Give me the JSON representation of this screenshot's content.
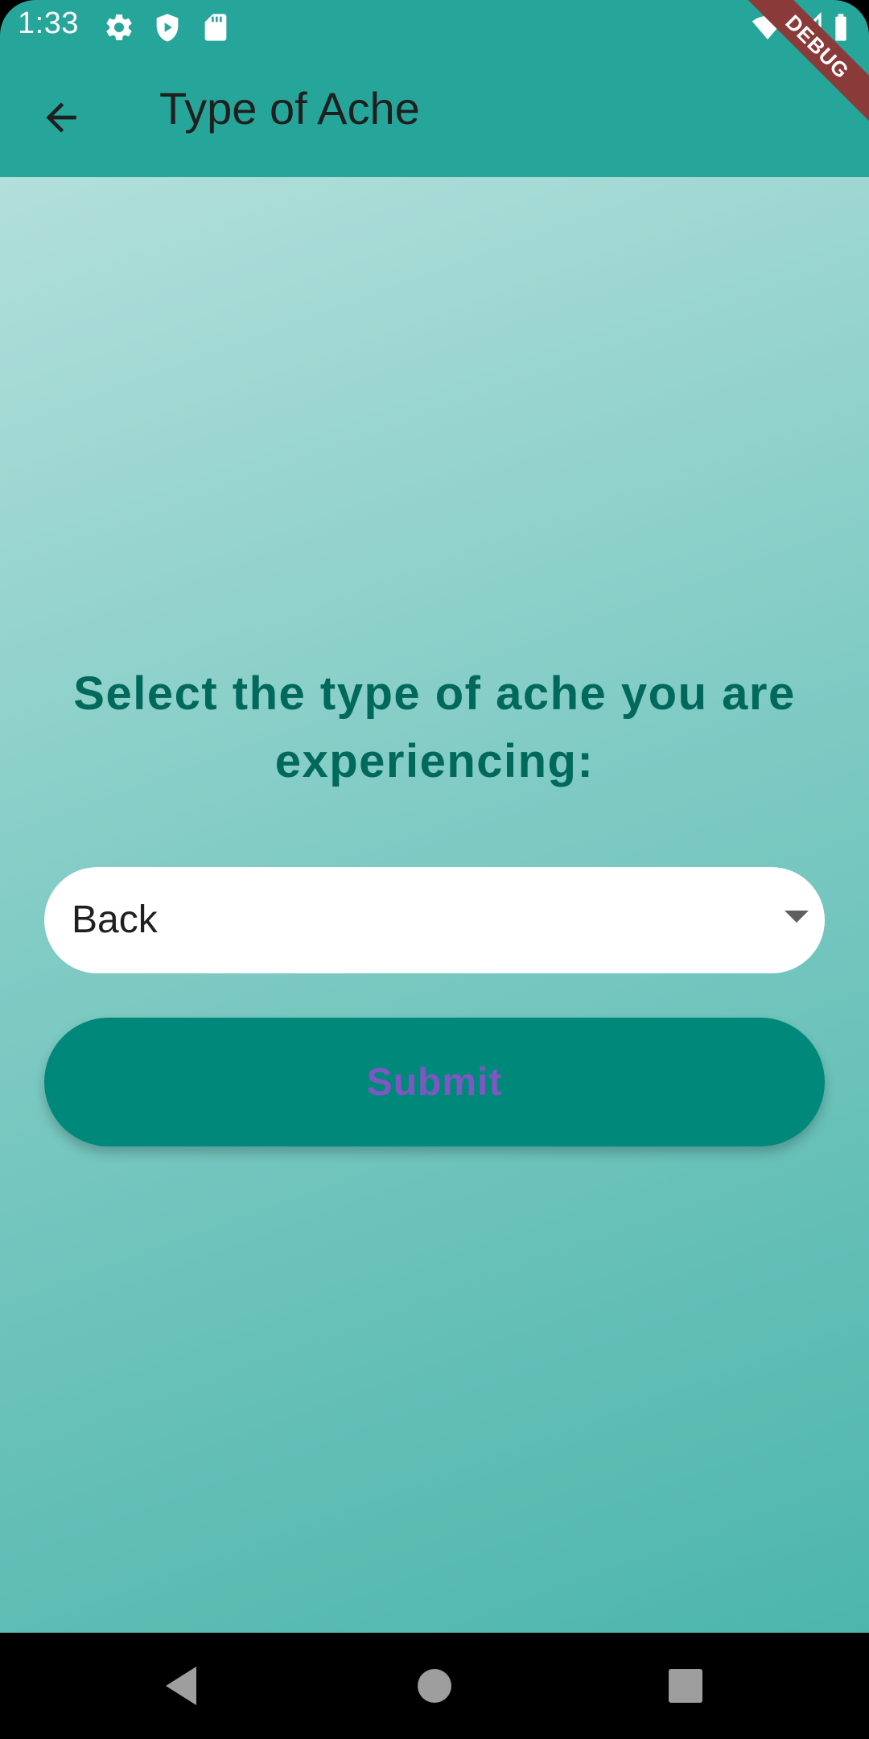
{
  "status_bar": {
    "time": "1:33",
    "left_icons": [
      "settings-icon",
      "shield-play-icon",
      "sd-card-icon"
    ],
    "right_icons": [
      "wifi-icon",
      "signal-icon",
      "battery-icon"
    ]
  },
  "debug_banner": {
    "label": "DEBUG",
    "color": "#8b3a3a"
  },
  "app_bar": {
    "title": "Type of Ache",
    "back_icon": "arrow-back-icon",
    "color": "#26a69a"
  },
  "main": {
    "prompt": "Select the type of ache you are experiencing:",
    "dropdown": {
      "selected_value": "Back",
      "icon": "arrow-drop-down-icon"
    },
    "submit": {
      "label": "Submit",
      "button_color": "#00897b",
      "label_color": "#7e57c2"
    }
  },
  "nav_bar": {
    "buttons": [
      "nav-back-icon",
      "nav-home-icon",
      "nav-recents-icon"
    ]
  },
  "colors": {
    "primary": "#26a69a",
    "prompt_text": "#00695c",
    "gradient_start": "#b2dfdb",
    "gradient_end": "#4db6ac"
  }
}
